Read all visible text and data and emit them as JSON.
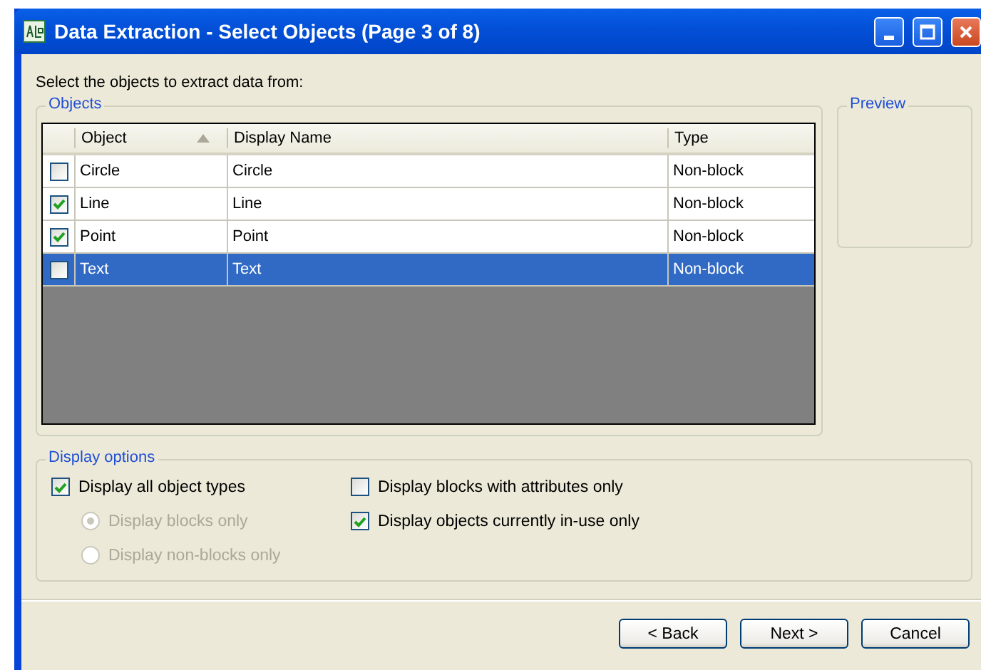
{
  "window": {
    "title": "Data Extraction - Select Objects (Page 3 of 8)"
  },
  "instruction": "Select the objects to extract data from:",
  "objects": {
    "label": "Objects",
    "columns": [
      {
        "label": "Object",
        "sorted": true
      },
      {
        "label": "Display Name",
        "sorted": false
      },
      {
        "label": "Type",
        "sorted": false
      }
    ],
    "rows": [
      {
        "checked": false,
        "selected": false,
        "object": "Circle",
        "display_name": "Circle",
        "type": "Non-block"
      },
      {
        "checked": true,
        "selected": false,
        "object": "Line",
        "display_name": "Line",
        "type": "Non-block"
      },
      {
        "checked": true,
        "selected": false,
        "object": "Point",
        "display_name": "Point",
        "type": "Non-block"
      },
      {
        "checked": false,
        "selected": true,
        "object": "Text",
        "display_name": "Text",
        "type": "Non-block"
      }
    ]
  },
  "preview": {
    "label": "Preview"
  },
  "display_options": {
    "label": "Display options",
    "left_options": [
      {
        "kind": "checkbox",
        "label": "Display all object types",
        "checked": true,
        "disabled": false
      },
      {
        "kind": "radio",
        "label": "Display blocks only",
        "checked": true,
        "disabled": true
      },
      {
        "kind": "radio",
        "label": "Display non-blocks only",
        "checked": false,
        "disabled": true
      }
    ],
    "right_options": [
      {
        "kind": "checkbox",
        "label": "Display blocks with attributes only",
        "checked": false,
        "disabled": false
      },
      {
        "kind": "checkbox",
        "label": "Display objects currently in-use only",
        "checked": true,
        "disabled": false
      }
    ]
  },
  "buttons": [
    "< Back",
    "Next >",
    "Cancel"
  ]
}
